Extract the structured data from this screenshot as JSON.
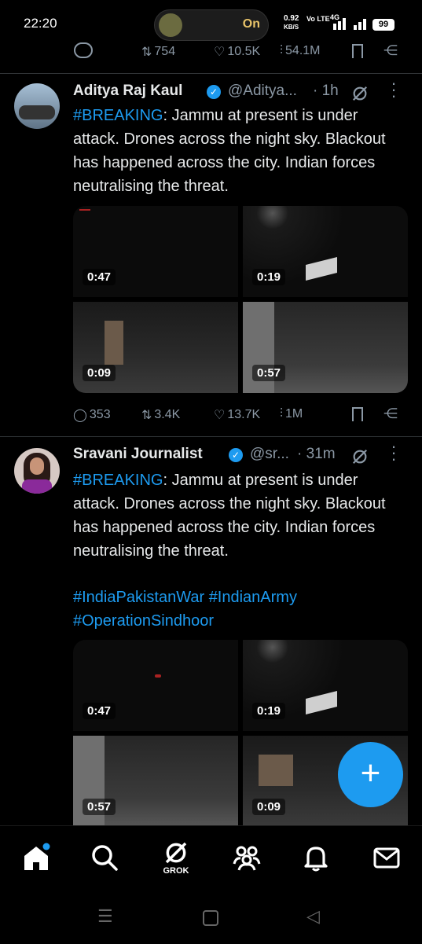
{
  "status_bar": {
    "time": "22:20",
    "pill_text": "On",
    "net_speed": "0.92",
    "net_unit": "KB/S",
    "network": "Vo LTE",
    "network2": "4G",
    "battery": "99"
  },
  "top_stats": {
    "retweets": "754",
    "likes": "10.5K",
    "views": "54.1M"
  },
  "tweet1": {
    "name": "Aditya Raj Kaul",
    "handle": "@Aditya...",
    "time": "· 1h",
    "hashtag": "#BREAKING",
    "text": ": Jammu at present is under attack. Drones across the night sky. Blackout has happened across the city. Indian forces neutralising the threat.",
    "videos": [
      "0:47",
      "0:19",
      "0:09",
      "0:57"
    ],
    "stats": {
      "replies": "353",
      "retweets": "3.4K",
      "likes": "13.7K",
      "views": "1M"
    }
  },
  "tweet2": {
    "name": "Sravani Journalist",
    "handle": "@sr...",
    "time": "· 31m",
    "hashtag": "#BREAKING",
    "text": ": Jammu at present is under attack. Drones across the night sky. Blackout has happened across the city. Indian forces neutralising the threat.",
    "tags_line1_a": "#IndiaPakistanWar",
    "tags_line1_b": "#IndianArmy",
    "tags_line2": "#OperationSindhoor",
    "videos": [
      "0:47",
      "0:19",
      "0:57",
      "0:09"
    ]
  },
  "nav": {
    "grok_label": "GROK",
    "fab": "+"
  },
  "colors": {
    "accent": "#1d9bf0",
    "muted": "#8b98a5",
    "background": "#000000"
  },
  "icons": [
    "home-icon",
    "search-icon",
    "grok-icon",
    "communities-icon",
    "notifications-icon",
    "messages-icon",
    "reply-icon",
    "retweet-icon",
    "like-icon",
    "views-icon",
    "bookmark-icon",
    "share-icon",
    "verified-icon",
    "more-icon"
  ]
}
